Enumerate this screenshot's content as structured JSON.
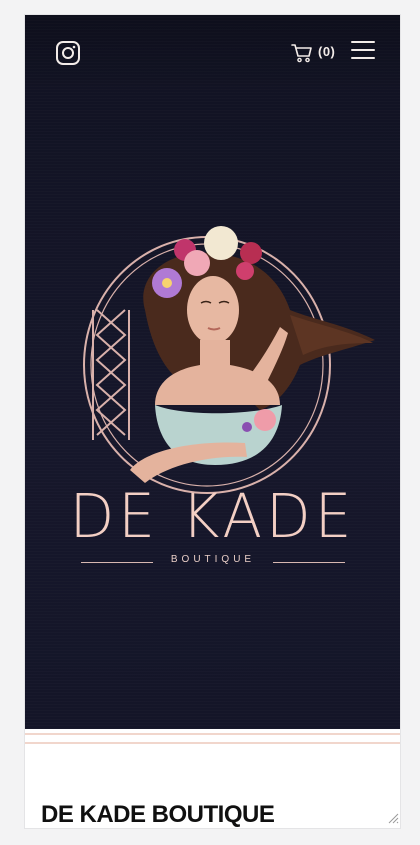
{
  "header": {
    "instagram_icon": "instagram-icon",
    "cart_icon": "cart-icon",
    "cart_count": "(0)",
    "menu_icon": "hamburger-menu-icon"
  },
  "hero": {
    "brand_name": "DE KADE",
    "brand_subtitle": "BOUTIQUE"
  },
  "content": {
    "section_title": "DE KADE BOUTIQUE"
  },
  "colors": {
    "hero_background": "#141528",
    "brand_pink": "#f3cfc4",
    "icon_light": "#f3ece9",
    "stripe": "#f1d6cc"
  }
}
